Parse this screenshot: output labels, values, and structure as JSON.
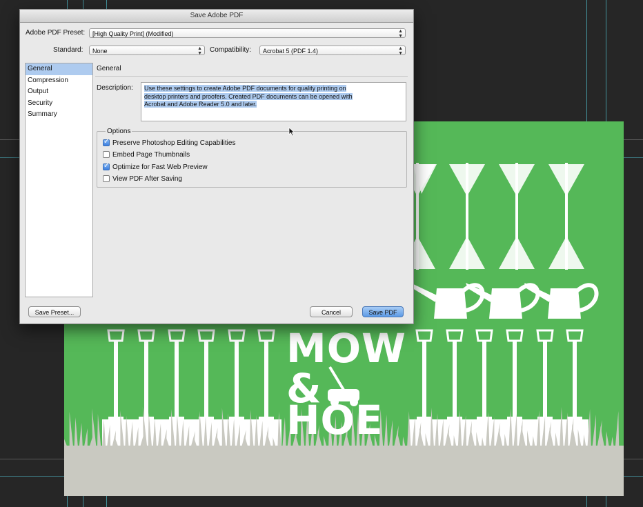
{
  "dialog": {
    "title": "Save Adobe PDF",
    "preset_label": "Adobe PDF Preset:",
    "preset_value": "[High Quality Print] (Modified)",
    "standard_label": "Standard:",
    "standard_value": "None",
    "compat_label": "Compatibility:",
    "compat_value": "Acrobat 5 (PDF 1.4)",
    "sidebar": [
      "General",
      "Compression",
      "Output",
      "Security",
      "Summary"
    ],
    "selected_index": 0,
    "section_title": "General",
    "description_label": "Description:",
    "description_lines": [
      "Use these settings to create Adobe PDF documents for quality printing on",
      "desktop printers and proofers.  Created PDF documents can be opened with",
      "Acrobat and Adobe Reader 5.0 and later."
    ],
    "options_legend": "Options",
    "options": [
      {
        "label": "Preserve Photoshop Editing Capabilities",
        "checked": true
      },
      {
        "label": "Embed Page Thumbnails",
        "checked": false
      },
      {
        "label": "Optimize for Fast Web Preview",
        "checked": true
      },
      {
        "label": "View PDF After Saving",
        "checked": false
      }
    ],
    "buttons": {
      "save_preset": "Save Preset...",
      "cancel": "Cancel",
      "save_pdf": "Save PDF"
    }
  },
  "artwork": {
    "logo_lines": [
      "MOW",
      "&",
      "HOE"
    ],
    "background_color": "#55b858",
    "canvas_color": "#262626",
    "guide_color": "#4fb8c6"
  }
}
